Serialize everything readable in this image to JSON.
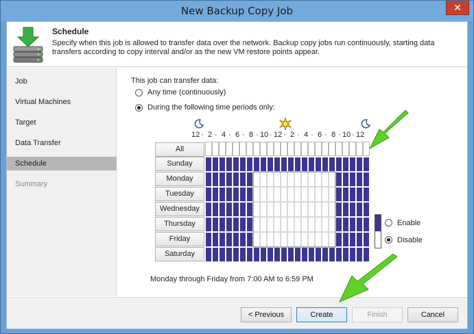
{
  "window": {
    "title": "New Backup Copy Job",
    "close_glyph": "✕"
  },
  "header": {
    "title": "Schedule",
    "description": "Specify when this job is allowed to transfer data over the network. Backup copy jobs run continuously, starting data transfers according to copy interval and/or as the new VM restore points appear.",
    "icon": "server-download-icon"
  },
  "sidebar": {
    "items": [
      {
        "label": "Job",
        "state": "normal"
      },
      {
        "label": "Virtual Machines",
        "state": "normal"
      },
      {
        "label": "Target",
        "state": "normal"
      },
      {
        "label": "Data Transfer",
        "state": "normal"
      },
      {
        "label": "Schedule",
        "state": "active"
      },
      {
        "label": "Summary",
        "state": "disabled"
      }
    ]
  },
  "schedule": {
    "heading": "This job can transfer data:",
    "option_anytime": "Any time (continuously)",
    "option_periods": "During the following time periods only:",
    "selected_option": "periods",
    "hour_scale": [
      "12",
      "·",
      "2",
      "·",
      "4",
      "·",
      "6",
      "·",
      "8",
      "·",
      "10",
      "·",
      "12",
      "·",
      "2",
      "·",
      "4",
      "·",
      "6",
      "·",
      "8",
      "·",
      "10",
      "·",
      "12"
    ],
    "all_label": "All",
    "days": [
      "Sunday",
      "Monday",
      "Tuesday",
      "Wednesday",
      "Thursday",
      "Friday",
      "Saturday"
    ],
    "enabled_color": "#3d3590",
    "disabled_color": "#ffffff",
    "legend_enable": "Enable",
    "legend_disable": "Disable",
    "legend_selected": "disable",
    "summary": "Monday through Friday from 7:00 AM to 6:59 PM",
    "disabled_window": {
      "days": [
        "Monday",
        "Tuesday",
        "Wednesday",
        "Thursday",
        "Friday"
      ],
      "from_hour": 7,
      "to_hour": 18
    }
  },
  "footer": {
    "previous_label": "< Previous",
    "create_label": "Create",
    "finish_label": "Finish",
    "cancel_label": "Cancel"
  }
}
